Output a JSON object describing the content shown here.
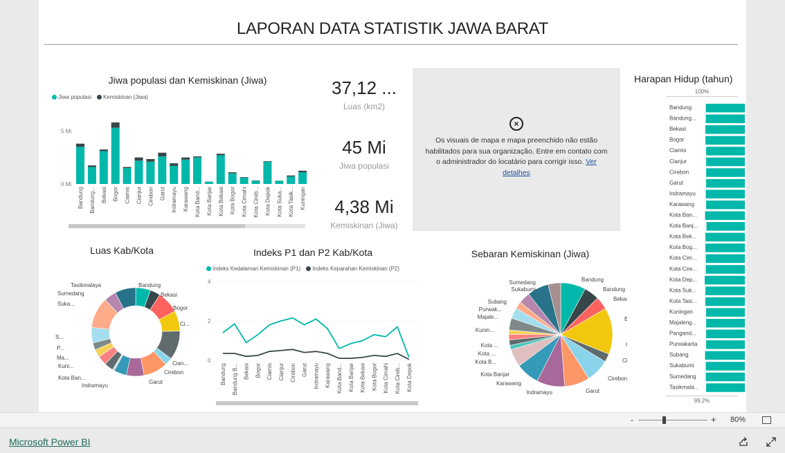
{
  "report": {
    "title": "LAPORAN DATA STATISTIK JAWA BARAT"
  },
  "colors": {
    "teal": "#01b8aa",
    "dark": "#374649",
    "accent": "#01b8aa"
  },
  "bar_chart": {
    "title": "Jiwa populasi dan Kemiskinan (Jiwa)",
    "legend": [
      "Jiwa populasi",
      "Kemiskinan (Jiwa)"
    ],
    "y_ticks": [
      "5 Mi",
      "0 Mi"
    ]
  },
  "cards": [
    {
      "value": "37,12 ...",
      "label": "Luas (km2)"
    },
    {
      "value": "45 Mi",
      "label": "Jiwa populasi"
    },
    {
      "value": "4,38 Mi",
      "label": "Kemiskinan (Jiwa)"
    }
  ],
  "map_notice": {
    "icon": "close-circle-icon",
    "text": "Os visuais de mapa e mapa preenchido não estão habilitados para sua organização. Entre em contato com o administrador do locatário para corrigir isso.",
    "link": "Ver detalhes"
  },
  "harapan": {
    "title": "Harapan Hidup (tahun)",
    "top_label": "100%",
    "bottom_label": "99.2%",
    "rows": [
      "Bandung",
      "Bandung...",
      "Bekasi",
      "Bogor",
      "Ciamis",
      "Cianjur",
      "Cirebon",
      "Garut",
      "Indramayu",
      "Karawang",
      "Kota Ban...",
      "Kota Banj...",
      "Kota Bek...",
      "Kota Bog...",
      "Kota Cim...",
      "Kota Cire...",
      "Kota Dep...",
      "Kota Suk...",
      "Kota Tasi...",
      "Kuningan",
      "Majaleng...",
      "Pangand...",
      "Purwakarta",
      "Subang",
      "Sukabumi",
      "Sumedang",
      "Tasikmala..."
    ],
    "widths": [
      0.97,
      0.97,
      0.98,
      0.98,
      0.96,
      0.96,
      0.96,
      0.96,
      0.97,
      0.96,
      0.99,
      0.95,
      0.98,
      0.98,
      0.97,
      0.97,
      1.0,
      0.98,
      0.98,
      0.96,
      0.96,
      0.96,
      0.96,
      0.99,
      0.97,
      0.97,
      0.96
    ]
  },
  "luas": {
    "title": "Luas Kab/Kota",
    "labels": [
      "Tasikmalaya",
      "Bandung",
      "Bekasi",
      "Sumedang",
      "Suka...",
      "Bogor",
      "Ci...",
      "S...",
      "P...",
      "Ma...",
      "Kuni...",
      "Kota Ban...",
      "Indramayu",
      "Cian...",
      "Cirebon",
      "Garut"
    ]
  },
  "line_chart": {
    "title": "Indeks P1 dan P2 Kab/Kota",
    "legend": [
      "Indeks Kedalaman Kemiskinan (P1)",
      "Indeks Keparahan Kemiskinan (P2)"
    ],
    "y_ticks": [
      "4",
      "2",
      "0"
    ]
  },
  "pie_chart": {
    "title": "Sebaran Kemiskinan (Jiwa)",
    "labels": [
      "Sumedang",
      "Bandung",
      "Sukabumi",
      "Bandung Barat",
      "Bekasi",
      "Subang",
      "Purwak...",
      "Majale...",
      "Bogor",
      "Kunin...",
      "Ciamis",
      "Kota ...",
      "Kota ...",
      "Cianjur",
      "Kota B...",
      "Kota Banjar",
      "Cirebon",
      "Karawang",
      "Indramayu",
      "Garut"
    ]
  },
  "chart_data": [
    {
      "type": "bar",
      "title": "Jiwa populasi dan Kemiskinan (Jiwa)",
      "categories": [
        "Bandung",
        "Bandung...",
        "Bekasi",
        "Bogor",
        "Ciamis",
        "Cianjur",
        "Cirebon",
        "Garut",
        "Indramayu",
        "Karawang",
        "Kota Band...",
        "Kota Banjar",
        "Kota Bekasi",
        "Kota Bogor",
        "Kota Cimahi",
        "Kota Cireb...",
        "Kota Depok",
        "Kota Suka...",
        "Kota Tasik...",
        "Kuningan"
      ],
      "series": [
        {
          "name": "Jiwa populasi",
          "values": [
            3.5,
            1.6,
            3.1,
            5.3,
            1.5,
            2.2,
            2.1,
            2.6,
            1.7,
            2.3,
            2.5,
            0.2,
            2.7,
            1.0,
            0.6,
            0.3,
            2.1,
            0.3,
            0.7,
            1.1
          ]
        },
        {
          "name": "Kemiskinan (Jiwa)",
          "values": [
            0.3,
            0.15,
            0.15,
            0.5,
            0.1,
            0.3,
            0.25,
            0.35,
            0.25,
            0.2,
            0.1,
            0.02,
            0.15,
            0.1,
            0.05,
            0.03,
            0.05,
            0.01,
            0.1,
            0.15
          ]
        }
      ],
      "ylim": [
        0,
        6
      ]
    },
    {
      "type": "line",
      "title": "Indeks P1 dan P2 Kab/Kota",
      "categories": [
        "Bandung",
        "Bandung B...",
        "Bekasi",
        "Bogor",
        "Ciamis",
        "Cianjur",
        "Cirebon",
        "Garut",
        "Indramayu",
        "Karawang",
        "Kota Band...",
        "Kota Banjar",
        "Kota Bekasi",
        "Kota Bogor",
        "Kota Cimahi",
        "Kota Cireb...",
        "Kota Depok"
      ],
      "series": [
        {
          "name": "Indeks Kedalaman Kemiskinan (P1)",
          "values": [
            1.4,
            1.85,
            0.9,
            1.3,
            1.8,
            2.0,
            2.15,
            1.8,
            2.1,
            1.6,
            0.6,
            0.85,
            1.0,
            1.3,
            1.2,
            1.7,
            0.15
          ]
        },
        {
          "name": "Indeks Keparahan Kemiskinan (P2)",
          "values": [
            0.35,
            0.35,
            0.2,
            0.25,
            0.45,
            0.5,
            0.55,
            0.4,
            0.45,
            0.35,
            0.1,
            0.1,
            0.15,
            0.25,
            0.2,
            0.35,
            0.05
          ]
        }
      ],
      "ylim": [
        0,
        4
      ]
    },
    {
      "type": "pie",
      "title": "Luas Kab/Kota",
      "categories": [
        "Bandung",
        "Bekasi",
        "Bogor",
        "Ciamis",
        "Cianjur",
        "Cirebon",
        "Garut",
        "Indramayu",
        "Karawang",
        "Kota Bandung",
        "Kota Banjar",
        "Kuningan",
        "Majalengka",
        "Pangandaran",
        "Purwakarta",
        "Subang",
        "Sukabumi",
        "Sumedang",
        "Tasikmalaya"
      ],
      "values": [
        5.0,
        3.4,
        7.5,
        6.8,
        9.8,
        2.5,
        8.2,
        5.9,
        4.3,
        0.4,
        0.3,
        3.0,
        3.2,
        2.6,
        2.4,
        5.2,
        10.4,
        4.1,
        7.0
      ]
    },
    {
      "type": "pie",
      "title": "Sebaran Kemiskinan (Jiwa)",
      "categories": [
        "Bandung",
        "Bandung Barat",
        "Bekasi",
        "Bogor",
        "Ciamis",
        "Cianjur",
        "Cirebon",
        "Garut",
        "Indramayu",
        "Karawang",
        "Kota Banjar",
        "Kota B...",
        "Kota ...",
        "Kota ...",
        "Kunin...",
        "Majale...",
        "Purwak...",
        "Subang",
        "Sukabumi",
        "Sumedang"
      ],
      "values": [
        7.0,
        4.2,
        3.6,
        13.0,
        2.3,
        6.5,
        7.0,
        7.8,
        6.5,
        5.0,
        1.2,
        1.5,
        1.6,
        1.2,
        3.3,
        3.0,
        2.0,
        3.2,
        6.0,
        3.5
      ]
    }
  ],
  "zoom": {
    "minus": "-",
    "plus": "+",
    "level": "80%"
  },
  "footer": {
    "brand": "Microsoft Power BI"
  }
}
